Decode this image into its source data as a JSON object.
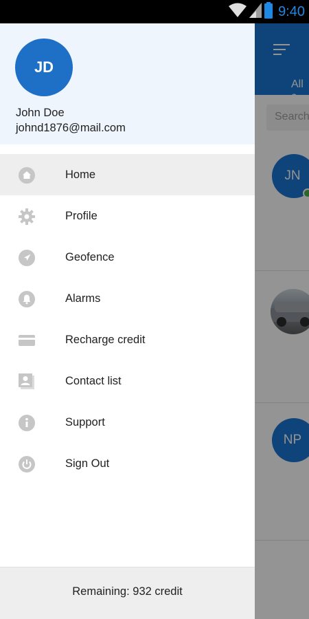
{
  "status_bar": {
    "time": "9:40",
    "icons": [
      "wifi-icon",
      "signal-icon",
      "battery-icon"
    ],
    "time_color": "#1e88e5"
  },
  "background_app": {
    "tab_label": "All c",
    "search_placeholder": "Search",
    "contacts": [
      {
        "initials": "JN",
        "status_color": "#4caf50"
      },
      {
        "initials": "",
        "type": "photo"
      },
      {
        "initials": "NP"
      }
    ],
    "toolbar_color": "#1976d2"
  },
  "drawer": {
    "avatar_initials": "JD",
    "avatar_color": "#1e6fc6",
    "user_name": "John Doe",
    "user_email": "johnd1876@mail.com",
    "menu": [
      {
        "label": "Home",
        "icon": "home-icon",
        "active": true
      },
      {
        "label": "Profile",
        "icon": "gear-icon",
        "active": false
      },
      {
        "label": "Geofence",
        "icon": "navigation-icon",
        "active": false
      },
      {
        "label": "Alarms",
        "icon": "bell-icon",
        "active": false
      },
      {
        "label": "Recharge credit",
        "icon": "credit-card-icon",
        "active": false
      },
      {
        "label": "Contact list",
        "icon": "contacts-icon",
        "active": false
      },
      {
        "label": "Support",
        "icon": "info-icon",
        "active": false
      },
      {
        "label": "Sign Out",
        "icon": "power-icon",
        "active": false
      }
    ],
    "footer": {
      "credit_text": "Remaining:  932 credit"
    }
  }
}
